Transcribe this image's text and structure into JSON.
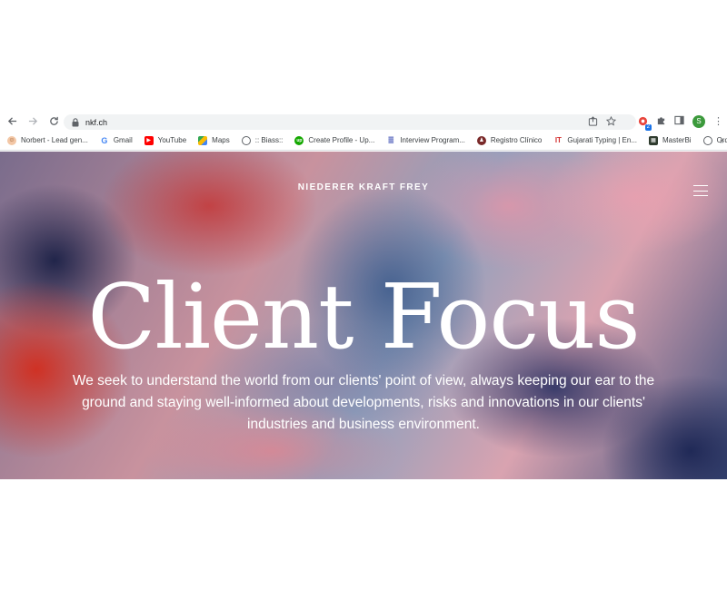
{
  "browser": {
    "url": "nkf.ch",
    "extension_badge": "2",
    "profile_initial": "S",
    "bookmarks": [
      {
        "label": "Norbert - Lead gen...",
        "icon": "norbert-icon"
      },
      {
        "label": "Gmail",
        "icon": "google-icon"
      },
      {
        "label": "YouTube",
        "icon": "youtube-icon"
      },
      {
        "label": "Maps",
        "icon": "maps-icon"
      },
      {
        "label": ":: Biass::",
        "icon": "globe-icon"
      },
      {
        "label": "Create Profile - Up...",
        "icon": "upwork-icon"
      },
      {
        "label": "Interview Program...",
        "icon": "document-icon"
      },
      {
        "label": "Registro Clínico",
        "icon": "registro-icon"
      },
      {
        "label": "Gujarati Typing | En...",
        "icon": "gujarati-icon"
      },
      {
        "label": "MasterBi",
        "icon": "masterbi-icon"
      },
      {
        "label": "Order Refund",
        "icon": "globe-icon"
      }
    ],
    "more_bookmarks": "»"
  },
  "site": {
    "brand": "NIEDERER KRAFT FREY",
    "headline": "Client Focus",
    "lede": "We seek to understand the world from our clients' point of view, always keeping our ear to the ground and staying well-informed about developments, risks and innovations in our clients' industries and business environment."
  },
  "colors": {
    "hero_red": "#d22d1e",
    "hero_navy": "#1c2654",
    "hero_pink": "#e8a0af",
    "hero_blue": "#3e5c8c",
    "accent_blue": "#1a73e8",
    "profile_green": "#3c9a3c"
  }
}
